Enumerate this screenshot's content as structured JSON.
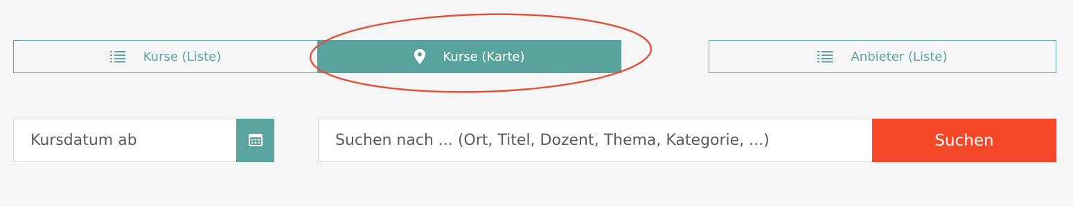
{
  "tabs": {
    "list": {
      "label": "Kurse (Liste)",
      "icon": "list-icon"
    },
    "map": {
      "label": "Kurse (Karte)",
      "icon": "map-pin-icon"
    },
    "providers": {
      "label": "Anbieter (Liste)",
      "icon": "list-icon"
    }
  },
  "filters": {
    "date_placeholder": "Kursdatum ab",
    "calendar_icon": "calendar-icon",
    "search_placeholder": "Suchen nach ... (Ort, Titel, Dozent, Thema, Kategorie, ...)",
    "search_button": "Suchen"
  },
  "colors": {
    "accent": "#5aa39e",
    "search_button": "#f44829",
    "annotation": "#e0533a",
    "background": "#f6f6f6"
  }
}
